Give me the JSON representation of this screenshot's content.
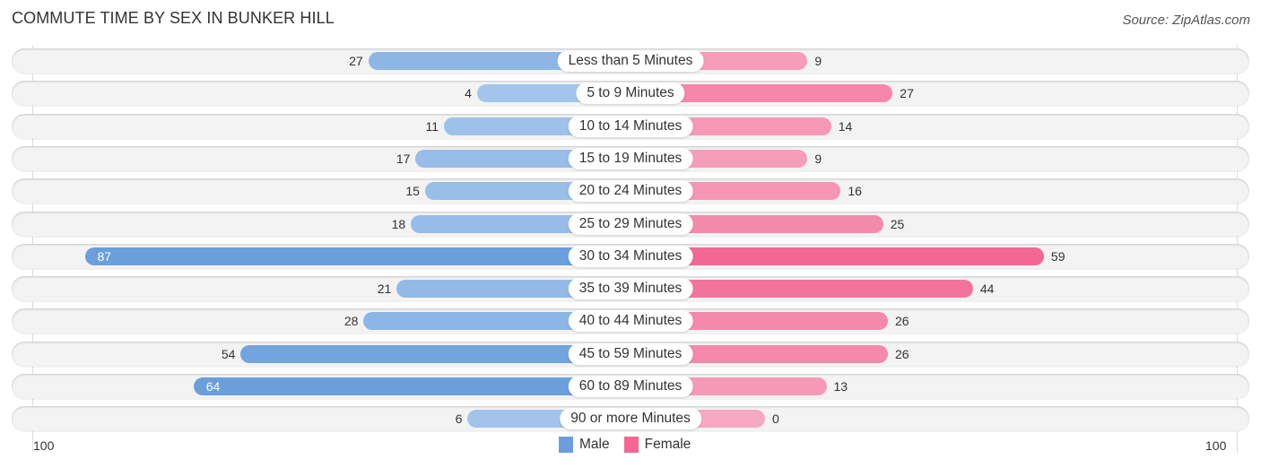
{
  "title": "COMMUTE TIME BY SEX IN BUNKER HILL",
  "source": "Source: ZipAtlas.com",
  "colors": {
    "male_strong": "#6a9fdc",
    "male_light": "#a8c8ec",
    "female_strong": "#f26892",
    "female_light": "#f7a8c2"
  },
  "chart_data": {
    "type": "bar",
    "orientation": "horizontal-diverging",
    "title": "COMMUTE TIME BY SEX IN BUNKER HILL",
    "categories": [
      "Less than 5 Minutes",
      "5 to 9 Minutes",
      "10 to 14 Minutes",
      "15 to 19 Minutes",
      "20 to 24 Minutes",
      "25 to 29 Minutes",
      "30 to 34 Minutes",
      "35 to 39 Minutes",
      "40 to 44 Minutes",
      "45 to 59 Minutes",
      "60 to 89 Minutes",
      "90 or more Minutes"
    ],
    "series": [
      {
        "name": "Male",
        "values": [
          27,
          4,
          11,
          17,
          15,
          18,
          87,
          21,
          28,
          54,
          64,
          6
        ]
      },
      {
        "name": "Female",
        "values": [
          9,
          27,
          14,
          9,
          16,
          25,
          59,
          44,
          26,
          26,
          13,
          0
        ]
      }
    ],
    "axis_ticks": {
      "left": "100",
      "right": "100"
    },
    "xlim": [
      -100,
      100
    ],
    "legend": {
      "position": "bottom-center",
      "entries": [
        "Male",
        "Female"
      ]
    },
    "grid": false
  }
}
